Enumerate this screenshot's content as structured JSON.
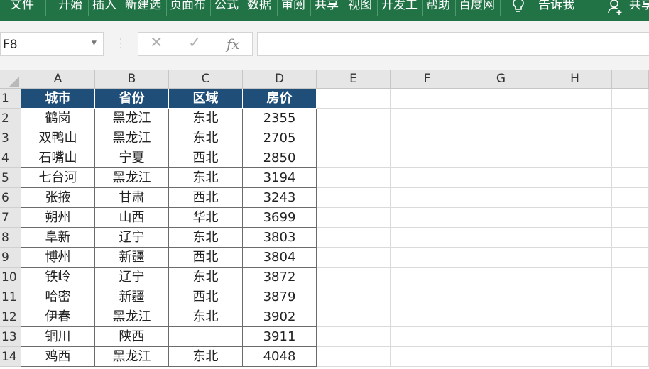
{
  "ribbon": {
    "tabs": [
      "文件",
      "开始",
      "插入",
      "新建选",
      "页面布",
      "公式",
      "数据",
      "审阅",
      "共享",
      "视图",
      "开发工",
      "帮助",
      "百度网"
    ],
    "tell_me": "告诉我",
    "share": "共享"
  },
  "formula_bar": {
    "name_box": "F8",
    "cancel_glyph": "✕",
    "enter_glyph": "✓",
    "fx_label": "fx",
    "formula": ""
  },
  "grid": {
    "columns": [
      "A",
      "B",
      "C",
      "D",
      "E",
      "F",
      "G",
      "H"
    ],
    "rows": [
      "1",
      "2",
      "3",
      "4",
      "5",
      "6",
      "7",
      "8",
      "9",
      "10",
      "11",
      "12",
      "13",
      "14"
    ],
    "header": [
      "城市",
      "省份",
      "区域",
      "房价"
    ],
    "data": [
      [
        "鹤岗",
        "黑龙江",
        "东北",
        "2355"
      ],
      [
        "双鸭山",
        "黑龙江",
        "东北",
        "2705"
      ],
      [
        "石嘴山",
        "宁夏",
        "西北",
        "2850"
      ],
      [
        "七台河",
        "黑龙江",
        "东北",
        "3194"
      ],
      [
        "张掖",
        "甘肃",
        "西北",
        "3243"
      ],
      [
        "朔州",
        "山西",
        "华北",
        "3699"
      ],
      [
        "阜新",
        "辽宁",
        "东北",
        "3803"
      ],
      [
        "博州",
        "新疆",
        "西北",
        "3804"
      ],
      [
        "铁岭",
        "辽宁",
        "东北",
        "3872"
      ],
      [
        "哈密",
        "新疆",
        "西北",
        "3879"
      ],
      [
        "伊春",
        "黑龙江",
        "东北",
        "3902"
      ],
      [
        "铜川",
        "陕西",
        "",
        "3911"
      ],
      [
        "鸡西",
        "黑龙江",
        "东北",
        "4048"
      ]
    ]
  },
  "colors": {
    "ribbon": "#217346",
    "header_fill": "#1f4e79"
  }
}
